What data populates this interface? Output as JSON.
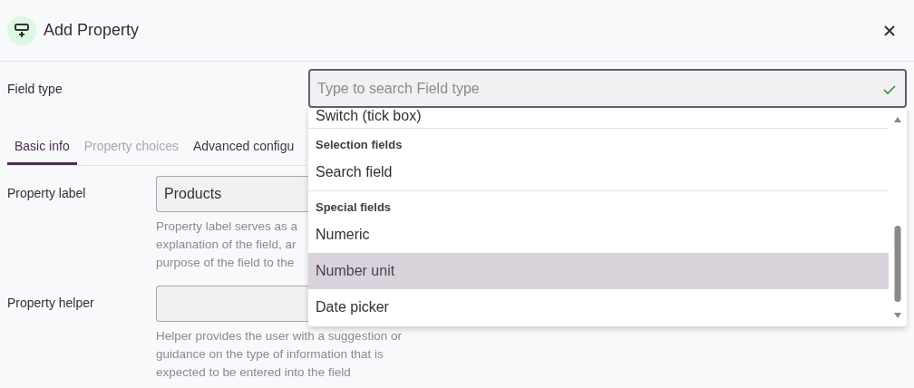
{
  "dialog": {
    "title": "Add Property"
  },
  "field_type": {
    "label": "Field type",
    "placeholder": "Type to search Field type",
    "valid": true
  },
  "dropdown": {
    "items": [
      {
        "kind": "option",
        "label": "Switch (tick box)",
        "selected": false
      },
      {
        "kind": "group",
        "label": "Selection fields"
      },
      {
        "kind": "option",
        "label": "Search field",
        "selected": false
      },
      {
        "kind": "group",
        "label": "Special fields"
      },
      {
        "kind": "option",
        "label": "Numeric",
        "selected": false
      },
      {
        "kind": "option",
        "label": "Number unit",
        "selected": true
      },
      {
        "kind": "option",
        "label": "Date picker",
        "selected": false
      }
    ]
  },
  "tabs": [
    {
      "label": "Basic info",
      "selected": true,
      "disabled": false
    },
    {
      "label": "Property choices",
      "selected": false,
      "disabled": true
    },
    {
      "label": "Advanced configu",
      "selected": false,
      "disabled": false
    }
  ],
  "form": [
    {
      "label": "Property label",
      "value": "Products",
      "helper_lines": [
        "Property label serves as a",
        "explanation of the field, ar",
        "purpose of the field to the"
      ]
    },
    {
      "label": "Property helper",
      "helper_lines": [
        "Helper provides the user with a suggestion or",
        "guidance on the type of information that is",
        "expected to be entered into the field"
      ]
    }
  ]
}
